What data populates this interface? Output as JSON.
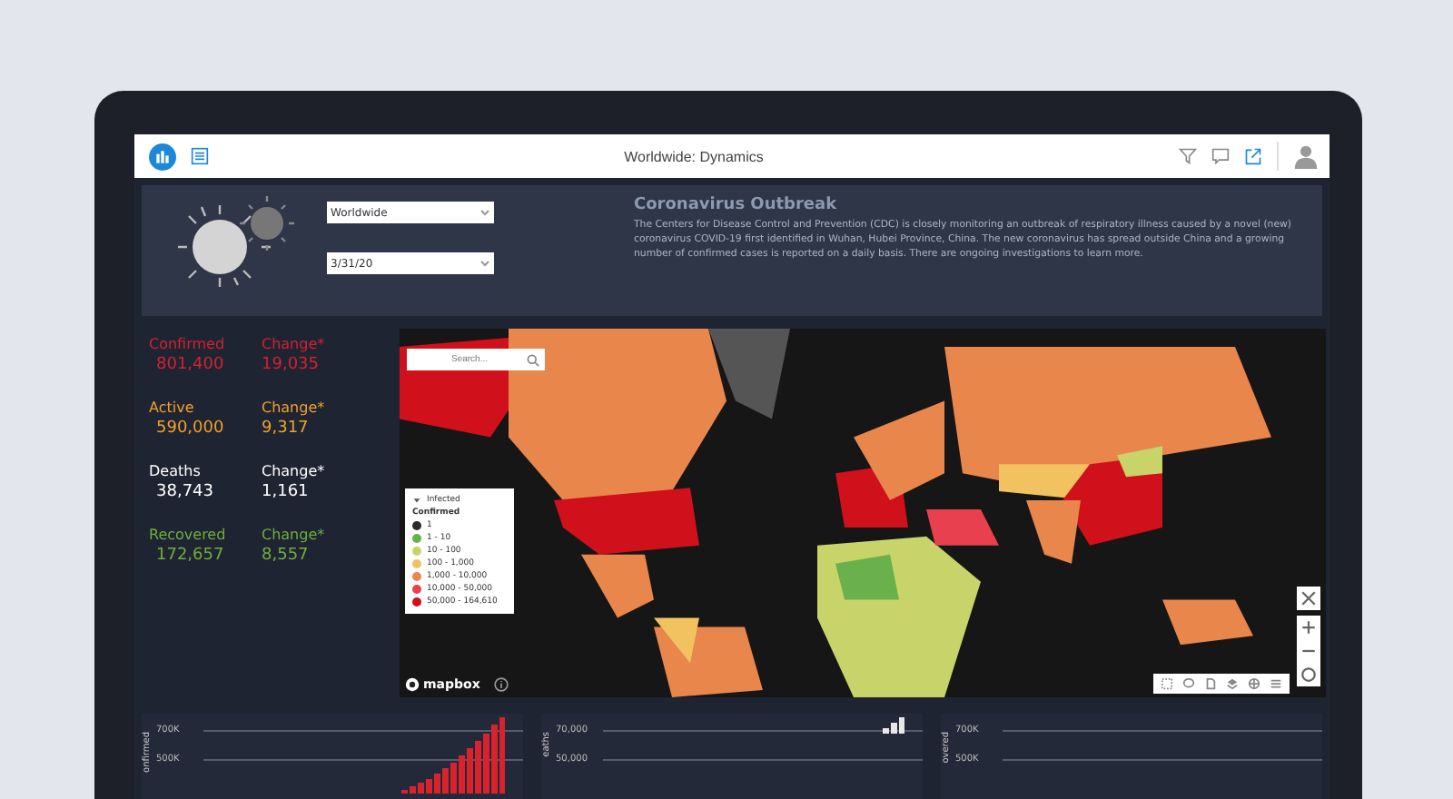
{
  "toolbar": {
    "title": "Worldwide: Dynamics"
  },
  "header": {
    "filters": [
      {
        "value": "Worldwide"
      },
      {
        "value": "3/31/20"
      }
    ],
    "heading": "Coronavirus Outbreak",
    "description": "The Centers for Disease Control and Prevention (CDC) is closely monitoring an outbreak of respiratory illness caused by a novel (new) coronavirus COVID-19 first identified in Wuhan, Hubei Province, China. The new coronavirus has spread outside China and a growing number of confirmed cases is reported on a daily basis. There are ongoing investigations to learn more."
  },
  "stats": [
    {
      "label": "Confirmed",
      "value": "801,400",
      "change_label": "Change*",
      "change": "19,035",
      "color": "#d0232e"
    },
    {
      "label": "Active",
      "value": "590,000",
      "change_label": "Change*",
      "change": "9,317",
      "color": "#f0a02a"
    },
    {
      "label": "Deaths",
      "value": "38,743",
      "change_label": "Change*",
      "change": "1,161",
      "color": "#ffffff"
    },
    {
      "label": "Recovered",
      "value": "172,657",
      "change_label": "Change*",
      "change": "8,557",
      "color": "#6fae3a"
    }
  ],
  "map": {
    "search": {
      "placeholder": "Search..."
    },
    "legend": {
      "layer": "Infected",
      "title": "Confirmed",
      "items": [
        {
          "label": "1",
          "color": "#2b2b2b"
        },
        {
          "label": "1 - 10",
          "color": "#6ab04c"
        },
        {
          "label": "10 - 100",
          "color": "#c8d46a"
        },
        {
          "label": "100 - 1,000",
          "color": "#f2c260"
        },
        {
          "label": "1,000 - 10,000",
          "color": "#e8864c"
        },
        {
          "label": "10,000 - 50,000",
          "color": "#e8404e"
        },
        {
          "label": "50,000 - 164,610",
          "color": "#d0101a"
        }
      ]
    },
    "attribution": "mapbox"
  },
  "charts": [
    {
      "axis_label": "onfirmed",
      "ticks": [
        "700K",
        "500K"
      ],
      "color": "#d8232e"
    },
    {
      "axis_label": "eaths",
      "ticks": [
        "70,000",
        "50,000"
      ],
      "color": "#e8e8e8"
    },
    {
      "axis_label": "overed",
      "ticks": [
        "700K",
        "500K"
      ]
    }
  ]
}
